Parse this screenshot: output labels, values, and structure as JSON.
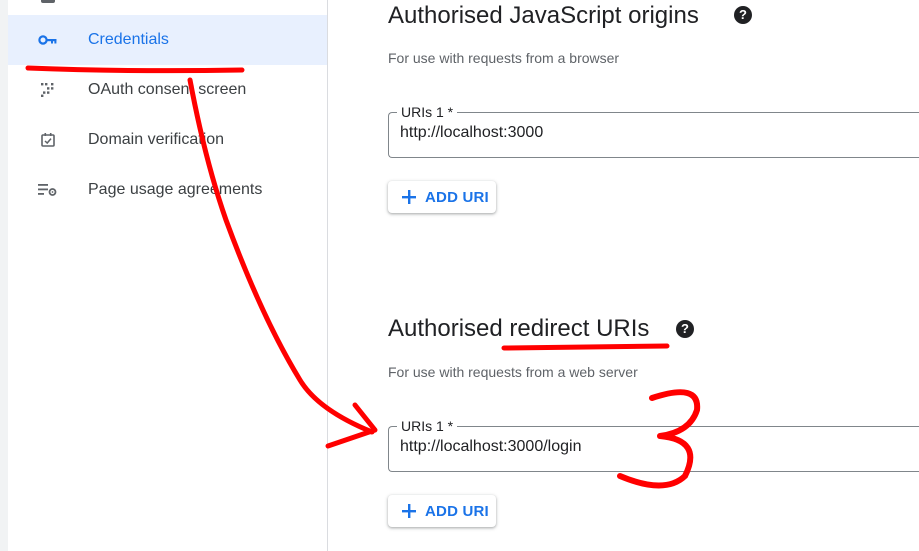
{
  "sidebar": {
    "items": [
      {
        "label": "Credentials",
        "icon": "key-icon",
        "active": true
      },
      {
        "label": "OAuth consent screen",
        "icon": "oauth-consent-icon",
        "active": false
      },
      {
        "label": "Domain verification",
        "icon": "checkbox-icon",
        "active": false
      },
      {
        "label": "Page usage agreements",
        "icon": "settings-list-icon",
        "active": false
      }
    ]
  },
  "js_origins": {
    "title": "Authorised JavaScript origins",
    "help": "?",
    "subtitle": "For use with requests from a browser",
    "field_label": "URIs 1 *",
    "field_value": "http://localhost:3000",
    "add_label": "ADD URI"
  },
  "redirect_uris": {
    "title": "Authorised redirect URIs",
    "help": "?",
    "subtitle": "For use with requests from a web server",
    "field_label": "URIs 1 *",
    "field_value": "http://localhost:3000/login",
    "add_label": "ADD URI"
  },
  "annotation": {
    "color": "#ff0000",
    "number": "3"
  },
  "colors": {
    "accent": "#1a73e8",
    "active_bg": "#e8f0fe",
    "annotation": "#ff0000"
  }
}
